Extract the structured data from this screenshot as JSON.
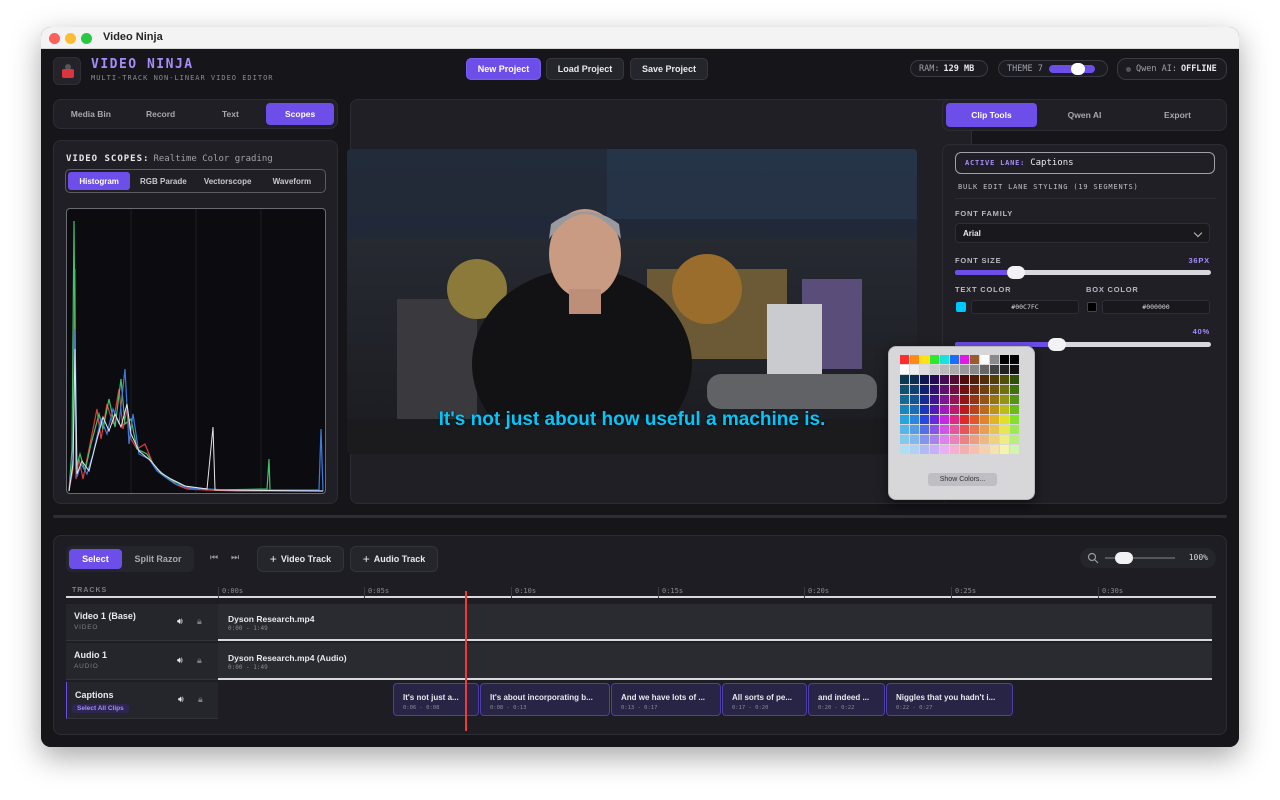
{
  "window": {
    "title": "Video Ninja"
  },
  "header": {
    "app_name": "VIDEO NINJA",
    "app_subtitle": "MULTI-TRACK NON-LINEAR VIDEO EDITOR",
    "buttons": {
      "new": "New Project",
      "load": "Load Project",
      "save": "Save Project"
    },
    "ram_label": "RAM:",
    "ram_value": "129 MB",
    "theme_label": "THEME 7",
    "ai_label": "Qwen AI:",
    "ai_status": "OFFLINE"
  },
  "left_panel": {
    "tabs": [
      "Media Bin",
      "Record",
      "Text",
      "Scopes"
    ],
    "active_tab": "Scopes",
    "scopes_title": "VIDEO SCOPES:",
    "scopes_subtitle": "Realtime Color grading",
    "scope_tabs": [
      "Histogram",
      "RGB Parade",
      "Vectorscope",
      "Waveform"
    ],
    "active_scope": "Histogram"
  },
  "preview": {
    "caption": "It's not just about how useful a machine is."
  },
  "right_panel": {
    "tabs": [
      "Clip Tools",
      "Qwen AI",
      "Export"
    ],
    "active_tab": "Clip Tools",
    "active_lane_label": "ACTIVE LANE:",
    "active_lane_value": "Captions",
    "bulk_edit": "BULK EDIT LANE STYLING (19 SEGMENTS)",
    "font_family_label": "FONT FAMILY",
    "font_family_value": "Arial",
    "font_size_label": "FONT SIZE",
    "font_size_value": "36PX",
    "font_size_fraction": 0.24,
    "text_color_label": "TEXT COLOR",
    "text_color_hex": "#00C7FC",
    "box_color_label": "BOX COLOR",
    "box_color_hex": "#000000",
    "opacity_value": "40%",
    "opacity_fraction": 0.4
  },
  "color_picker": {
    "show_colors": "Show Colors..."
  },
  "timeline": {
    "tools": [
      "Select",
      "Split Razor"
    ],
    "active_tool": "Select",
    "add_video": "Video Track",
    "add_audio": "Audio Track",
    "zoom": "100%",
    "tracks_header": "TRACKS",
    "ruler": [
      "0:00s",
      "0:05s",
      "0:10s",
      "0:15s",
      "0:20s",
      "0:25s",
      "0:30s"
    ],
    "tracks": [
      {
        "name": "Video 1 (Base)",
        "type": "VIDEO",
        "clip": "Dyson Research.mp4",
        "clip_time": "0:00 - 1:49"
      },
      {
        "name": "Audio 1",
        "type": "AUDIO",
        "clip": "Dyson Research.mp4 (Audio)",
        "clip_time": "0:00 - 1:49"
      },
      {
        "name": "Captions",
        "select_all": "Select All Clips"
      }
    ],
    "captions": [
      {
        "text": "It's not just a...",
        "time": "0:06 - 0:08"
      },
      {
        "text": "It's about incorporating b...",
        "time": "0:08 - 0:13"
      },
      {
        "text": "And we have lots of ...",
        "time": "0:13 - 0:17"
      },
      {
        "text": "All sorts of pe...",
        "time": "0:17 - 0:20"
      },
      {
        "text": "and indeed ...",
        "time": "0:20 - 0:22"
      },
      {
        "text": "Niggles that you hadn't i...",
        "time": "0:22 - 0:27"
      }
    ]
  }
}
